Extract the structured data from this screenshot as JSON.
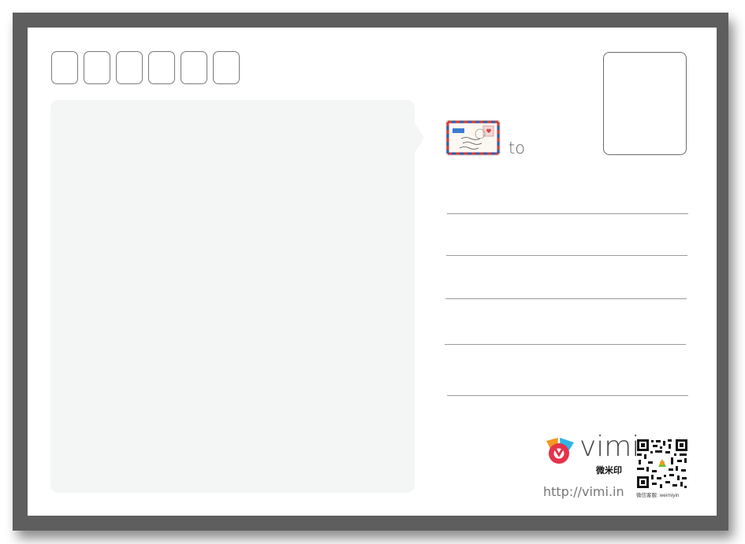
{
  "postcard": {
    "zip_boxes": [
      "",
      "",
      "",
      "",
      "",
      ""
    ],
    "to_label": "to",
    "address_lines": 5
  },
  "brand": {
    "name": "vimi",
    "name_cn": "微米印",
    "website": "http://vimi.in",
    "qr_caption": "微信客服: weimiyin"
  },
  "icons": {
    "envelope": "airmail-envelope-icon",
    "logo": "vimi-logo-icon",
    "qr": "qr-code"
  },
  "colors": {
    "frame": "#5e5e5e",
    "card": "#ffffff",
    "message_area": "#f4f5f5",
    "logo_orange": "#f39a1e",
    "logo_blue": "#2fb5e6",
    "logo_red": "#e5334b"
  }
}
